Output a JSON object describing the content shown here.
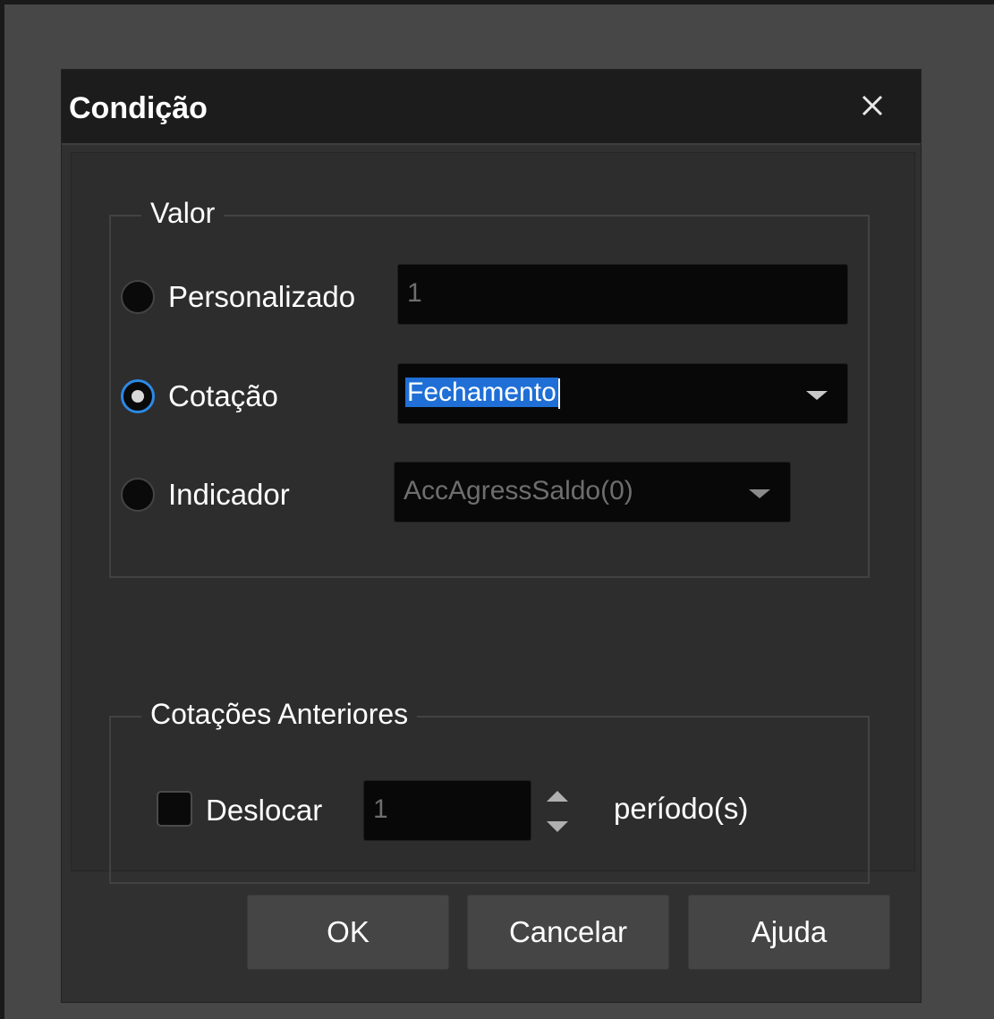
{
  "dialog": {
    "title": "Condição",
    "close_icon": "close-icon"
  },
  "valor_group": {
    "legend": "Valor",
    "options": {
      "personalizado": {
        "label": "Personalizado",
        "checked": false,
        "value": "1"
      },
      "cotacao": {
        "label": "Cotação",
        "checked": true,
        "value": "Fechamento"
      },
      "indicador": {
        "label": "Indicador",
        "checked": false,
        "value": "AccAgressSaldo(0)"
      }
    }
  },
  "cotacoes_group": {
    "legend": "Cotações Anteriores",
    "deslocar_label": "Deslocar",
    "deslocar_checked": false,
    "periods_value": "1",
    "periods_suffix": "período(s)"
  },
  "buttons": {
    "ok": "OK",
    "cancel": "Cancelar",
    "help": "Ajuda"
  },
  "colors": {
    "accent": "#2b8ae6",
    "selection": "#1f6fd6",
    "background": "#303030",
    "titlebar": "#1c1c1c"
  }
}
